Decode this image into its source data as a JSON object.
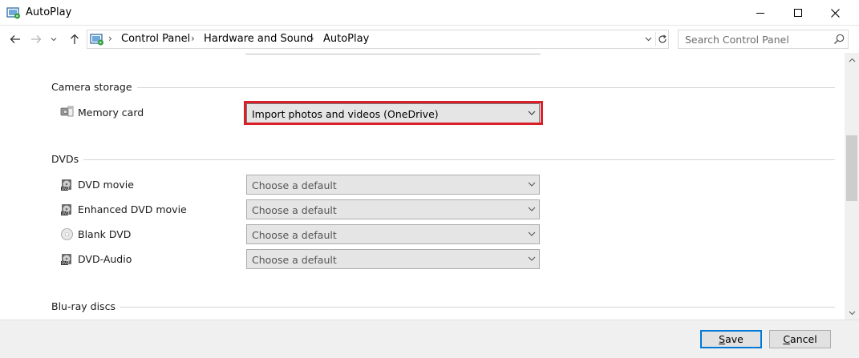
{
  "window": {
    "title": "AutoPlay",
    "icon": "autoplay-control-panel-icon"
  },
  "navigation": {
    "breadcrumbs": [
      "Control Panel",
      "Hardware and Sound",
      "AutoPlay"
    ],
    "search_placeholder": "Search Control Panel"
  },
  "sections": [
    {
      "title": "Camera storage",
      "rows": [
        {
          "label": "Memory card",
          "icon": "memory-card-icon",
          "value": "Import photos and videos (OneDrive)",
          "highlighted": true
        }
      ]
    },
    {
      "title": "DVDs",
      "rows": [
        {
          "label": "DVD movie",
          "icon": "dvd-icon",
          "value": "Choose a default"
        },
        {
          "label": "Enhanced DVD movie",
          "icon": "dvd-icon",
          "value": "Choose a default"
        },
        {
          "label": "Blank DVD",
          "icon": "blank-disc-icon",
          "value": "Choose a default"
        },
        {
          "label": "DVD-Audio",
          "icon": "dvd-icon",
          "value": "Choose a default"
        }
      ]
    },
    {
      "title": "Blu-ray discs",
      "rows": []
    }
  ],
  "buttons": {
    "save": {
      "mnemonic": "S",
      "rest": "ave"
    },
    "cancel": {
      "mnemonic": "C",
      "rest": "ancel"
    }
  },
  "colors": {
    "highlight": "#d9202a",
    "default_button_border": "#0078d7",
    "dropdown_bg": "#e5e5e5"
  }
}
